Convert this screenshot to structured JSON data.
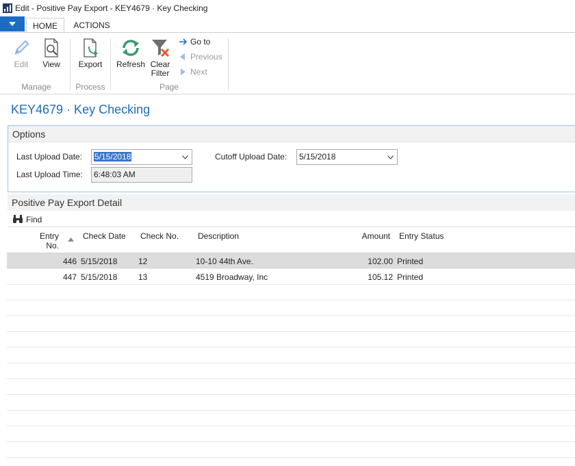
{
  "window": {
    "title": "Edit - Positive Pay Export - KEY4679 · Key Checking"
  },
  "tabs": {
    "home": "HOME",
    "actions": "ACTIONS"
  },
  "ribbon": {
    "edit": "Edit",
    "view": "View",
    "export": "Export",
    "refresh": "Refresh",
    "clear_filter_1": "Clear",
    "clear_filter_2": "Filter",
    "goto": "Go to",
    "previous": "Previous",
    "next": "Next",
    "groups": {
      "manage": "Manage",
      "process": "Process",
      "page": "Page"
    }
  },
  "page": {
    "title": "KEY4679 · Key Checking"
  },
  "options": {
    "header": "Options",
    "last_upload_date_label": "Last Upload Date:",
    "last_upload_date": "5/15/2018",
    "last_upload_time_label": "Last Upload Time:",
    "last_upload_time": "6:48:03 AM",
    "cutoff_upload_date_label": "Cutoff Upload Date:",
    "cutoff_upload_date": "5/15/2018"
  },
  "detail": {
    "header": "Positive Pay Export Detail",
    "find": "Find",
    "columns": {
      "entry_no_1": "Entry",
      "entry_no_2": "No.",
      "check_date": "Check Date",
      "check_no": "Check No.",
      "description": "Description",
      "amount": "Amount",
      "entry_status": "Entry Status"
    },
    "rows": [
      {
        "entry_no": "446",
        "check_date": "5/15/2018",
        "check_no": "12",
        "description": "10-10 44th Ave.",
        "amount": "102.00",
        "status": "Printed"
      },
      {
        "entry_no": "447",
        "check_date": "5/15/2018",
        "check_no": "13",
        "description": "4519 Broadway, Inc",
        "amount": "105.12",
        "status": "Printed"
      }
    ]
  },
  "colors": {
    "accent": "#1a6dc3",
    "title_blue": "#1e6cb5",
    "selection": "#3b74c6"
  }
}
